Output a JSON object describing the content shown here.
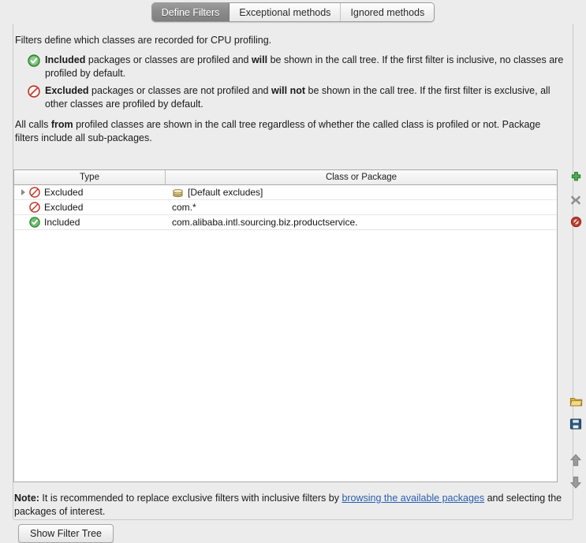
{
  "tabs": [
    {
      "label": "Define Filters",
      "active": true
    },
    {
      "label": "Exceptional methods",
      "active": false
    },
    {
      "label": "Ignored methods",
      "active": false
    }
  ],
  "intro": {
    "lead": "Filters define which classes are recorded for CPU profiling.",
    "included_bullet": {
      "strong": "Included",
      "text_before_bold": " packages or classes are profiled and ",
      "bold_mid": "will",
      "text_after": " be shown in the call tree. If the first filter is inclusive, no classes are profiled by default.",
      "icon": "included-check-icon"
    },
    "excluded_bullet": {
      "strong": "Excluded",
      "text_before_bold": " packages or classes are not profiled and ",
      "bold_mid": "will not",
      "text_after": " be shown in the call tree. If the first filter is exclusive, all other classes are profiled by default.",
      "icon": "excluded-deny-icon"
    },
    "closing_pre": "All calls ",
    "closing_bold": "from",
    "closing_post": " profiled classes are shown in the call tree regardless of whether the called class is profiled or not. Package filters include all sub-packages."
  },
  "table": {
    "columns": [
      "Type",
      "Class or Package"
    ],
    "rows": [
      {
        "expandable": true,
        "type": "Excluded",
        "type_icon": "excluded-deny-icon",
        "class_icon": "package-stack-icon",
        "class_or_package": "[Default excludes]"
      },
      {
        "expandable": false,
        "type": "Excluded",
        "type_icon": "excluded-deny-icon",
        "class_icon": null,
        "class_or_package": "com.*"
      },
      {
        "expandable": false,
        "type": "Included",
        "type_icon": "included-check-icon",
        "class_icon": null,
        "class_or_package": "com.alibaba.intl.sourcing.biz.productservice."
      }
    ]
  },
  "toolbar": {
    "add": "add-filter-icon",
    "remove": "remove-filter-icon",
    "reset": "reset-filter-icon",
    "open": "open-folder-icon",
    "save": "save-disk-icon",
    "move_up": "move-up-icon",
    "move_down": "move-down-icon"
  },
  "footer": {
    "note_label": "Note:",
    "note_text_before": " It is recommended to replace exclusive filters with inclusive filters by ",
    "link_text": "browsing the available packages",
    "note_text_after": " and selecting the packages of interest.",
    "button_label": "Show Filter Tree"
  },
  "colors": {
    "background": "#ececec",
    "link": "#2a5db0",
    "included_green": "#3f9e3f",
    "excluded_red": "#c0392b",
    "table_bg": "#ffffff"
  }
}
